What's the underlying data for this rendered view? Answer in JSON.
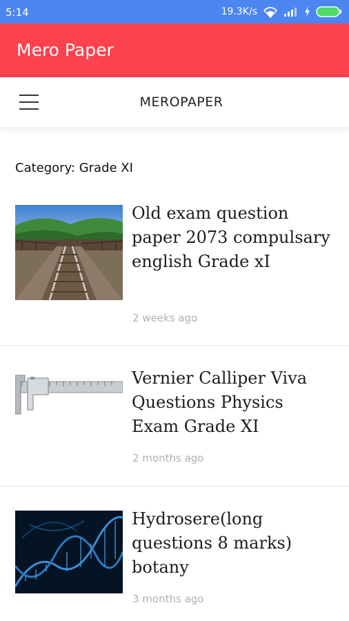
{
  "status": {
    "time": "5:14",
    "speed": "19.3K/s"
  },
  "app": {
    "title": "Mero Paper"
  },
  "site": {
    "brand": "MEROPAPER"
  },
  "category_label": "Category: Grade XI",
  "posts": [
    {
      "title": "Old exam question paper 2073 compulsary english Grade xI",
      "time": "2 weeks ago",
      "image": "railway-track-image"
    },
    {
      "title": "Vernier Calliper Viva Questions Physics Exam Grade XI",
      "time": "2 months ago",
      "image": "vernier-caliper-image"
    },
    {
      "title": "Hydrosere(long questions 8 marks) botany",
      "time": "3 months ago",
      "image": "dna-helix-image"
    }
  ],
  "icons": {
    "wifi": "wifi-icon",
    "signal": "signal-icon",
    "charging": "charging-icon",
    "battery": "battery-icon",
    "menu": "hamburger-menu-icon"
  },
  "colors": {
    "status_bar": "#4d86f0",
    "app_bar": "#fd424f",
    "battery": "#4cd964"
  }
}
